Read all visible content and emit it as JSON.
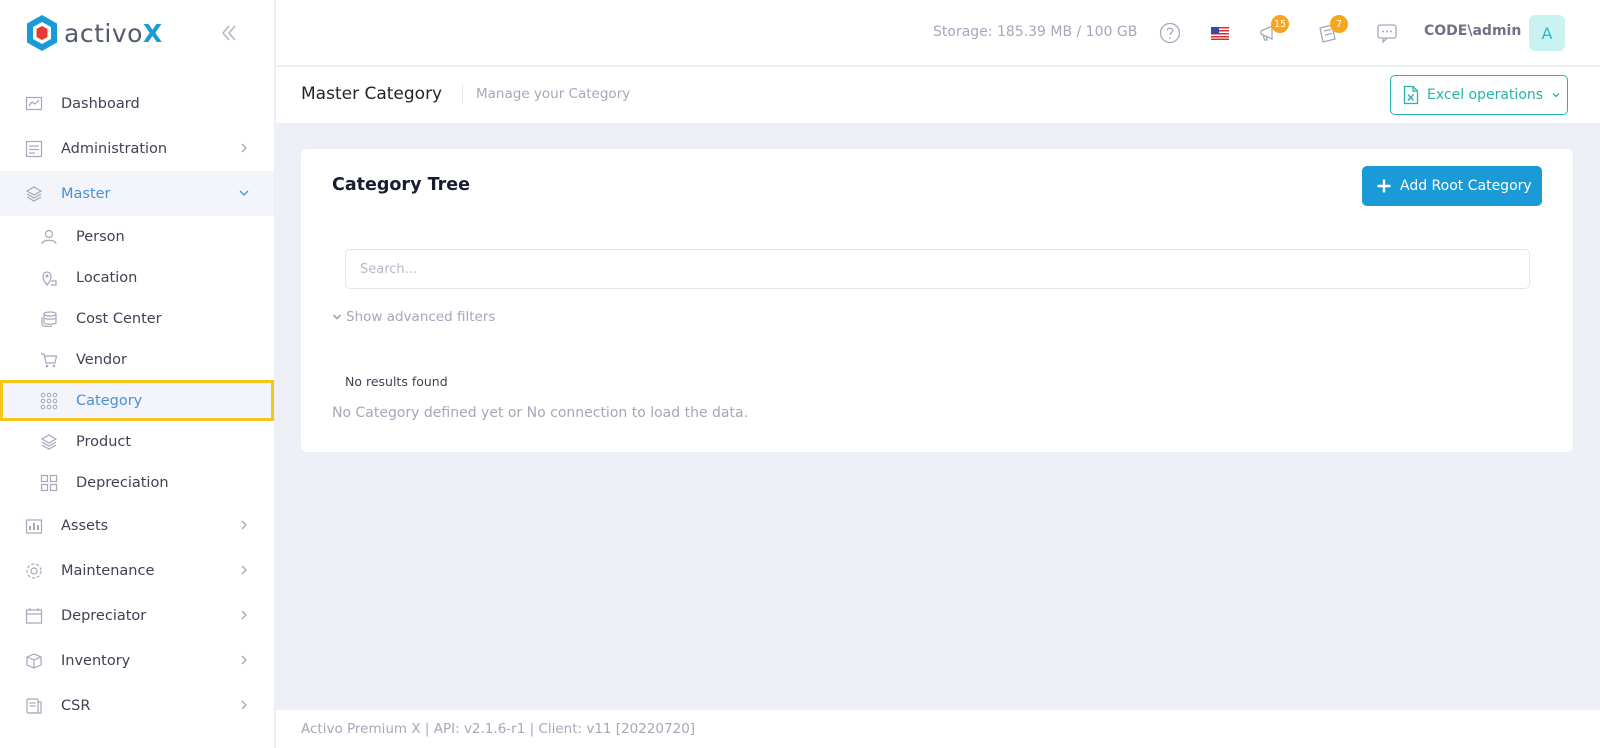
{
  "brand": {
    "name_main": "activo",
    "name_accent": "X"
  },
  "header": {
    "storage": "Storage: 185.39 MB / 100 GB",
    "notifications_count": "15",
    "tasks_count": "7",
    "user": "CODE\\admin",
    "avatar_initial": "A"
  },
  "sidebar": {
    "items": [
      {
        "label": "Dashboard",
        "icon": "chart-icon"
      },
      {
        "label": "Administration",
        "icon": "admin-icon"
      },
      {
        "label": "Master",
        "icon": "layers-icon"
      },
      {
        "label": "Assets",
        "icon": "assets-icon"
      },
      {
        "label": "Maintenance",
        "icon": "gear-icon"
      },
      {
        "label": "Depreciator",
        "icon": "calendar-icon"
      },
      {
        "label": "Inventory",
        "icon": "box-icon"
      },
      {
        "label": "CSR",
        "icon": "printer-icon"
      }
    ],
    "master_sub": [
      {
        "label": "Person",
        "icon": "person-icon"
      },
      {
        "label": "Location",
        "icon": "location-icon"
      },
      {
        "label": "Cost Center",
        "icon": "coins-icon"
      },
      {
        "label": "Vendor",
        "icon": "cart-icon"
      },
      {
        "label": "Category",
        "icon": "grid-dots-icon"
      },
      {
        "label": "Product",
        "icon": "layers-icon"
      },
      {
        "label": "Depreciation",
        "icon": "squares-icon"
      }
    ]
  },
  "subheader": {
    "title": "Master Category",
    "subtitle": "Manage your Category",
    "excel_label": "Excel operations"
  },
  "card": {
    "title": "Category Tree",
    "add_label": "Add Root Category",
    "search_placeholder": "Search...",
    "advanced_filters": "Show advanced filters",
    "no_results": "No results found",
    "no_category": "No Category defined yet or No connection to load the data."
  },
  "footer": {
    "text": "Activo Premium X | API: v2.1.6-r1 | Client: v11 [20220720]"
  },
  "colors": {
    "accent": "#1a9bd7",
    "excel": "#26b3a8",
    "highlight": "#f5c518",
    "badge": "#f7a51c"
  }
}
